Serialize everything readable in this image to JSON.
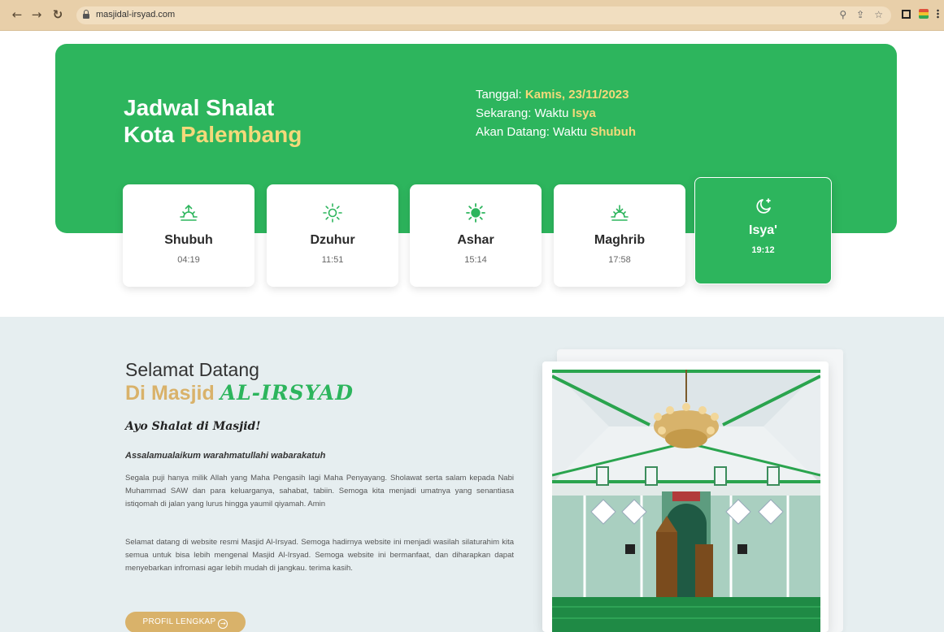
{
  "browser": {
    "url": "masjidal-irsyad.com",
    "nav_icons": [
      "back-arrow-icon",
      "forward-arrow-icon",
      "reload-icon"
    ],
    "omnibox_icons": [
      "zoom-icon",
      "share-icon",
      "bookmark-star-icon"
    ]
  },
  "hero": {
    "title_line1": "Jadwal Shalat",
    "title_prefix": "Kota ",
    "city": "Palembang",
    "date_label": "Tanggal: ",
    "date_value": "Kamis, 23/11/2023",
    "now_label": "Sekarang: Waktu ",
    "now_value": "Isya",
    "next_label": "Akan Datang: Waktu ",
    "next_value": "Shubuh"
  },
  "prayers": [
    {
      "name": "Shubuh",
      "time": "04:19",
      "icon": "sunrise-icon"
    },
    {
      "name": "Dzuhur",
      "time": "11:51",
      "icon": "sun-outline-icon"
    },
    {
      "name": "Ashar",
      "time": "15:14",
      "icon": "sun-filled-icon"
    },
    {
      "name": "Maghrib",
      "time": "17:58",
      "icon": "sunset-icon"
    },
    {
      "name": "Isya'",
      "time": "19:12",
      "icon": "moon-star-icon",
      "active": true
    }
  ],
  "welcome": {
    "heading1": "Selamat Datang",
    "heading2_prefix": "Di Masjid ",
    "heading2_brand": "AL-IRSYAD",
    "subheading": "Ayo Shalat di Masjid!",
    "greeting": "Assalamualaikum warahmatullahi wabarakatuh",
    "paragraph1": "Segala puji hanya milik Allah yang Maha Pengasih lagi Maha Penyayang. Sholawat serta salam kepada Nabi Muhammad SAW dan para keluarganya, sahabat, tabiin. Semoga kita menjadi umatnya yang senantiasa istiqomah di jalan yang lurus hingga yaumil qiyamah. Amin",
    "paragraph2": "Selamat datang di website resmi Masjid Al-Irsyad. Semoga hadirnya website ini menjadi wasilah silaturahim kita semua untuk bisa lebih mengenal Masjid Al-Irsyad. Semoga website ini bermanfaat, dan diharapkan dapat menyebarkan infromasi agar lebih mudah di jangkau. terima kasih.",
    "button": "PROFIL LENGKAP"
  },
  "colors": {
    "primary_green": "#2db55d",
    "accent_gold": "#d9b26a",
    "accent_yellow": "#f4d97a",
    "section_bg": "#e6eef0"
  }
}
